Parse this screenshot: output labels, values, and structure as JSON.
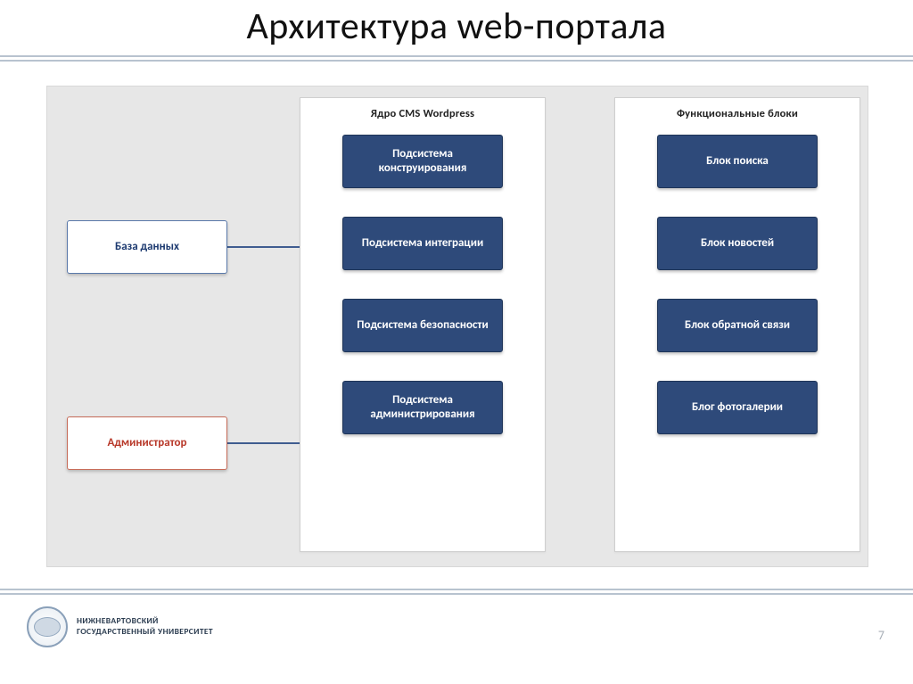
{
  "slide": {
    "title": "Архитектура web-портала",
    "page_number": "7"
  },
  "columns": {
    "core": {
      "title": "Ядро CMS Wordpress",
      "items": [
        "Подсистема конструирования",
        "Подсистема интеграции",
        "Подсистема безопасности",
        "Подсистема администрирования"
      ]
    },
    "functional": {
      "title": "Функциональные блоки",
      "items": [
        "Блок поиска",
        "Блок новостей",
        "Блок обратной связи",
        "Блог фотогалерии"
      ]
    }
  },
  "external": {
    "database": "База данных",
    "administrator": "Администратор"
  },
  "footer": {
    "org_line1": "НИЖНЕВАРТОВСКИЙ",
    "org_line2": "ГОСУДАРСТВЕННЫЙ УНИВЕРСИТЕТ"
  }
}
